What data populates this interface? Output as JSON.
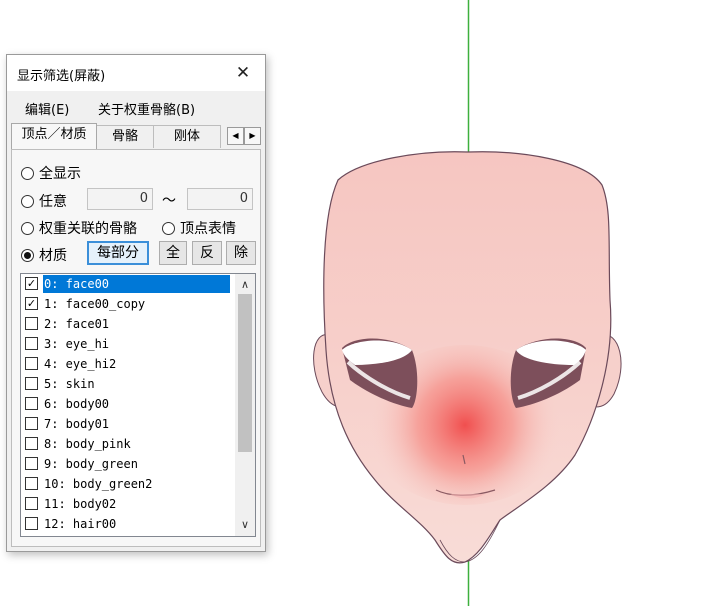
{
  "window": {
    "title": "显示筛选(屏蔽)",
    "close_glyph": "✕"
  },
  "menu": {
    "edit": "编辑(E)",
    "about_weight_bones": "关于权重骨骼(B)"
  },
  "tabs": [
    {
      "label": "顶点／材质",
      "active": true
    },
    {
      "label": "骨骼",
      "active": false
    },
    {
      "label": "刚体",
      "active": false
    }
  ],
  "tab_scroll": {
    "left": "◀",
    "right": "▶"
  },
  "options": {
    "show_all": "全显示",
    "arbitrary": "任意",
    "range_from": "0",
    "range_sep": "〜",
    "range_to": "0",
    "weight_bones": "权重关联的骨骼",
    "vertex_morph": "顶点表情",
    "material": "材质",
    "selected_option": "material"
  },
  "buttons": {
    "per_part": "每部分",
    "all": "全",
    "invert": "反",
    "remove": "除"
  },
  "materials": [
    {
      "label": "0: face00",
      "checked": true,
      "selected": true
    },
    {
      "label": "1: face00_copy",
      "checked": true,
      "selected": false
    },
    {
      "label": "2: face01",
      "checked": false,
      "selected": false
    },
    {
      "label": "3: eye_hi",
      "checked": false,
      "selected": false
    },
    {
      "label": "4: eye_hi2",
      "checked": false,
      "selected": false
    },
    {
      "label": "5: skin",
      "checked": false,
      "selected": false
    },
    {
      "label": "6: body00",
      "checked": false,
      "selected": false
    },
    {
      "label": "7: body01",
      "checked": false,
      "selected": false
    },
    {
      "label": "8: body_pink",
      "checked": false,
      "selected": false
    },
    {
      "label": "9: body_green",
      "checked": false,
      "selected": false
    },
    {
      "label": "10: body_green2",
      "checked": false,
      "selected": false
    },
    {
      "label": "11: body02",
      "checked": false,
      "selected": false
    },
    {
      "label": "12: hair00",
      "checked": false,
      "selected": false
    }
  ],
  "scrollbar": {
    "up": "∧",
    "down": "∨"
  },
  "colors": {
    "selection": "#0078d7",
    "axis_line": "#3db03d",
    "skin": "#f5c9c3",
    "blush": "#f05a5a"
  },
  "icons": {
    "checkmark": "✓"
  }
}
